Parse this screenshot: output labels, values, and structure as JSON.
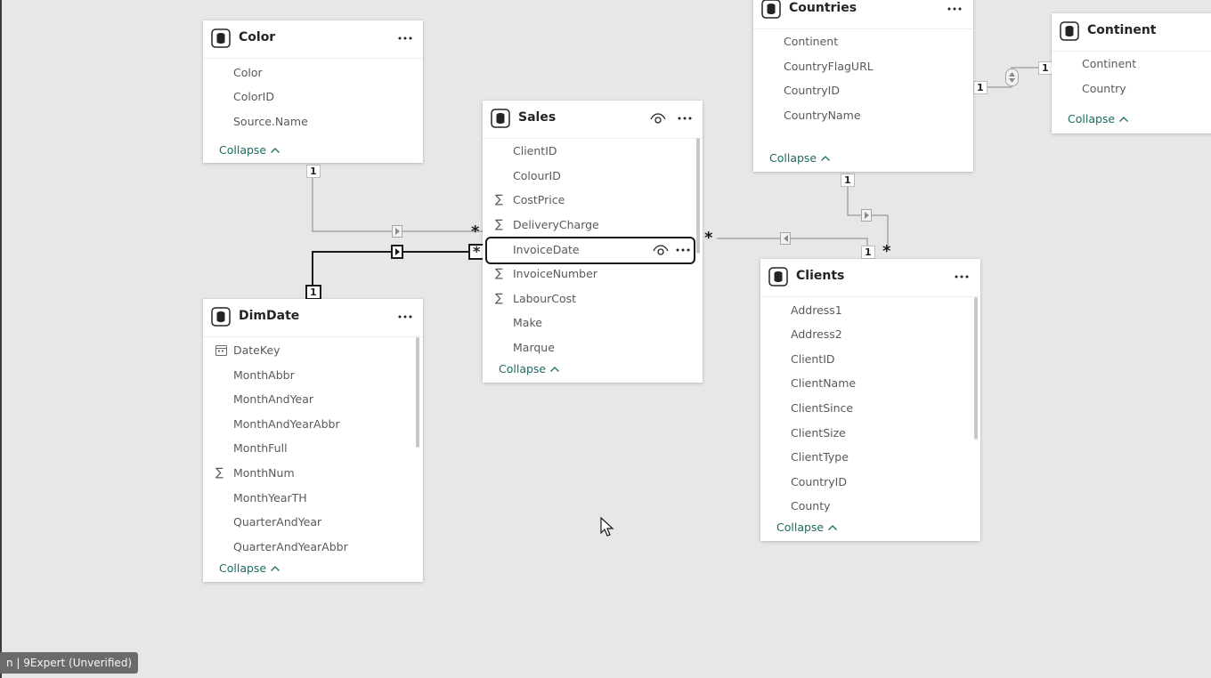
{
  "tables": {
    "color": {
      "title": "Color",
      "fields": [
        {
          "name": "Color",
          "icon": ""
        },
        {
          "name": "ColorID",
          "icon": ""
        },
        {
          "name": "Source.Name",
          "icon": ""
        }
      ],
      "collapse": "Collapse"
    },
    "sales": {
      "title": "Sales",
      "fields": [
        {
          "name": "ClientID",
          "icon": ""
        },
        {
          "name": "ColourID",
          "icon": ""
        },
        {
          "name": "CostPrice",
          "icon": "sigma"
        },
        {
          "name": "DeliveryCharge",
          "icon": "sigma"
        },
        {
          "name": "InvoiceDate",
          "icon": "",
          "selected": true
        },
        {
          "name": "InvoiceNumber",
          "icon": "sigma"
        },
        {
          "name": "LabourCost",
          "icon": "sigma"
        },
        {
          "name": "Make",
          "icon": ""
        },
        {
          "name": "Marque",
          "icon": ""
        }
      ],
      "collapse": "Collapse"
    },
    "countries": {
      "title": "Countries",
      "fields": [
        {
          "name": "Continent",
          "icon": ""
        },
        {
          "name": "CountryFlagURL",
          "icon": ""
        },
        {
          "name": "CountryID",
          "icon": ""
        },
        {
          "name": "CountryName",
          "icon": ""
        }
      ],
      "collapse": "Collapse"
    },
    "continent": {
      "title": "Continent",
      "fields": [
        {
          "name": "Continent",
          "icon": ""
        },
        {
          "name": "Country",
          "icon": ""
        }
      ],
      "collapse": "Collapse"
    },
    "dimdate": {
      "title": "DimDate",
      "fields": [
        {
          "name": "DateKey",
          "icon": "calendar"
        },
        {
          "name": "MonthAbbr",
          "icon": ""
        },
        {
          "name": "MonthAndYear",
          "icon": ""
        },
        {
          "name": "MonthAndYearAbbr",
          "icon": ""
        },
        {
          "name": "MonthFull",
          "icon": ""
        },
        {
          "name": "MonthNum",
          "icon": "sigma"
        },
        {
          "name": "MonthYearTH",
          "icon": ""
        },
        {
          "name": "QuarterAndYear",
          "icon": ""
        },
        {
          "name": "QuarterAndYearAbbr",
          "icon": ""
        }
      ],
      "collapse": "Collapse"
    },
    "clients": {
      "title": "Clients",
      "fields": [
        {
          "name": "Address1",
          "icon": ""
        },
        {
          "name": "Address2",
          "icon": ""
        },
        {
          "name": "ClientID",
          "icon": ""
        },
        {
          "name": "ClientName",
          "icon": ""
        },
        {
          "name": "ClientSince",
          "icon": ""
        },
        {
          "name": "ClientSize",
          "icon": ""
        },
        {
          "name": "ClientType",
          "icon": ""
        },
        {
          "name": "CountryID",
          "icon": ""
        },
        {
          "name": "County",
          "icon": ""
        }
      ],
      "collapse": "Collapse"
    }
  },
  "relationships": {
    "one_label": "1",
    "many_label": "*"
  },
  "watermark": "n | 9Expert (Unverified)",
  "symbols": {
    "sigma": "∑",
    "caret_up": "^"
  },
  "colors": {
    "canvas": "#e8e7e6",
    "link": "#1b6b61",
    "selected_border": "#1a1a1a"
  }
}
